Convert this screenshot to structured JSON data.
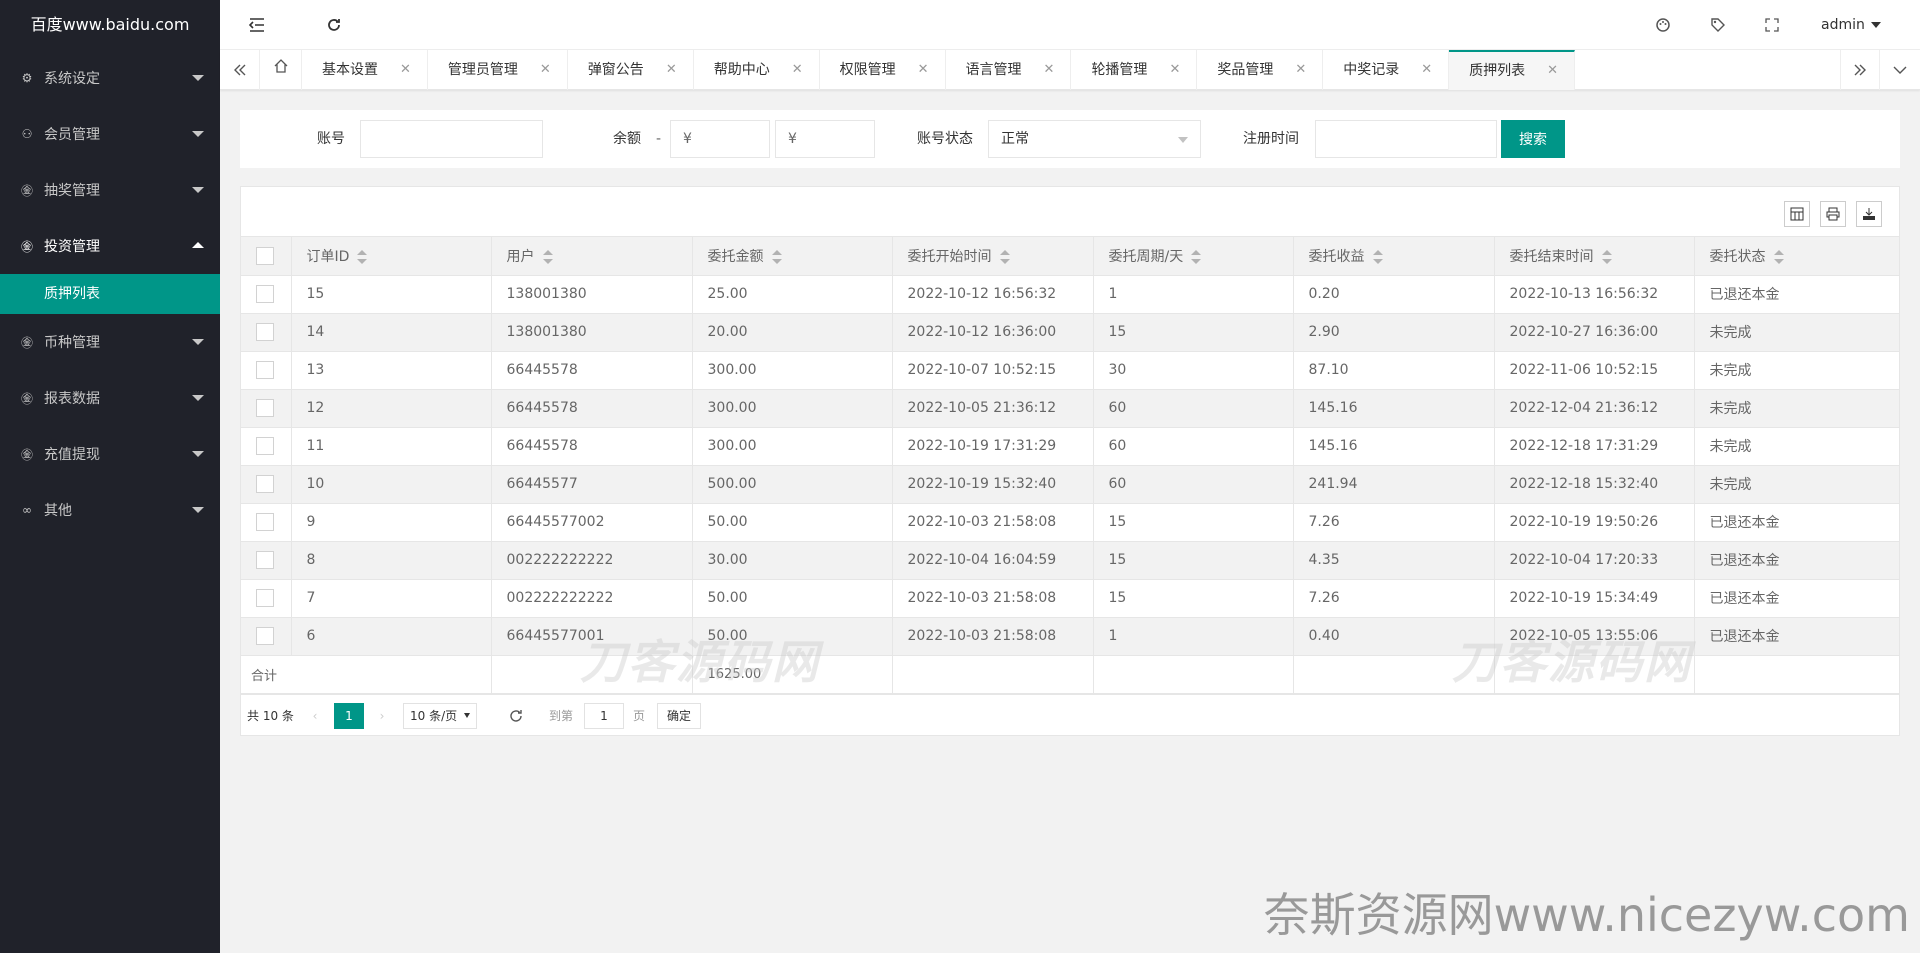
{
  "sidebar": {
    "logo": "百度www.baidu.com",
    "items": [
      {
        "label": "系统设定",
        "icon": "gear-icon",
        "glyph": "⚙"
      },
      {
        "label": "会员管理",
        "icon": "user-icon",
        "glyph": "⚇"
      },
      {
        "label": "抽奖管理",
        "icon": "currency-icon",
        "glyph": "㊎"
      },
      {
        "label": "投资管理",
        "icon": "currency-icon",
        "glyph": "㊎"
      },
      {
        "label": "币种管理",
        "icon": "currency-icon",
        "glyph": "㊎"
      },
      {
        "label": "报表数据",
        "icon": "currency-icon",
        "glyph": "㊎"
      },
      {
        "label": "充值提现",
        "icon": "currency-icon",
        "glyph": "㊎"
      },
      {
        "label": "其他",
        "icon": "link-icon",
        "glyph": "∞"
      }
    ],
    "sub_item": "质押列表"
  },
  "header": {
    "user": "admin"
  },
  "tabs": [
    "基本设置",
    "管理员管理",
    "弹窗公告",
    "帮助中心",
    "权限管理",
    "语言管理",
    "轮播管理",
    "奖品管理",
    "中奖记录",
    "质押列表"
  ],
  "filter": {
    "account_label": "账号",
    "balance_label": "余额",
    "dash": "-",
    "currency": "¥",
    "status_label": "账号状态",
    "status_value": "正常",
    "reg_label": "注册时间",
    "search_btn": "搜索"
  },
  "table": {
    "columns": [
      "订单ID",
      "用户",
      "委托金额",
      "委托开始时间",
      "委托周期/天",
      "委托收益",
      "委托结束时间",
      "委托状态"
    ],
    "rows": [
      [
        "15",
        "138001380",
        "25.00",
        "2022-10-12 16:56:32",
        "1",
        "0.20",
        "2022-10-13 16:56:32",
        "已退还本金"
      ],
      [
        "14",
        "138001380",
        "20.00",
        "2022-10-12 16:36:00",
        "15",
        "2.90",
        "2022-10-27 16:36:00",
        "未完成"
      ],
      [
        "13",
        "66445578",
        "300.00",
        "2022-10-07 10:52:15",
        "30",
        "87.10",
        "2022-11-06 10:52:15",
        "未完成"
      ],
      [
        "12",
        "66445578",
        "300.00",
        "2022-10-05 21:36:12",
        "60",
        "145.16",
        "2022-12-04 21:36:12",
        "未完成"
      ],
      [
        "11",
        "66445578",
        "300.00",
        "2022-10-19 17:31:29",
        "60",
        "145.16",
        "2022-12-18 17:31:29",
        "未完成"
      ],
      [
        "10",
        "66445577",
        "500.00",
        "2022-10-19 15:32:40",
        "60",
        "241.94",
        "2022-12-18 15:32:40",
        "未完成"
      ],
      [
        "9",
        "66445577002",
        "50.00",
        "2022-10-03 21:58:08",
        "15",
        "7.26",
        "2022-10-19 19:50:26",
        "已退还本金"
      ],
      [
        "8",
        "002222222222",
        "30.00",
        "2022-10-04 16:04:59",
        "15",
        "4.35",
        "2022-10-04 17:20:33",
        "已退还本金"
      ],
      [
        "7",
        "002222222222",
        "50.00",
        "2022-10-03 21:58:08",
        "15",
        "7.26",
        "2022-10-19 15:34:49",
        "已退还本金"
      ],
      [
        "6",
        "66445577001",
        "50.00",
        "2022-10-03 21:58:08",
        "1",
        "0.40",
        "2022-10-05 13:55:06",
        "已退还本金"
      ]
    ],
    "total_label": "合计",
    "total_amount": "1625.00"
  },
  "pager": {
    "total": "共 10 条",
    "current": "1",
    "page_size": "10 条/页",
    "goto_label": "到第",
    "goto_value": "1",
    "page_unit": "页",
    "confirm": "确定"
  },
  "watermarks": {
    "overlay": "刀客源码网",
    "site": "奈斯资源网www.nicezyw.com"
  },
  "colors": {
    "accent": "#009688",
    "sidebar_bg": "#20222a"
  }
}
